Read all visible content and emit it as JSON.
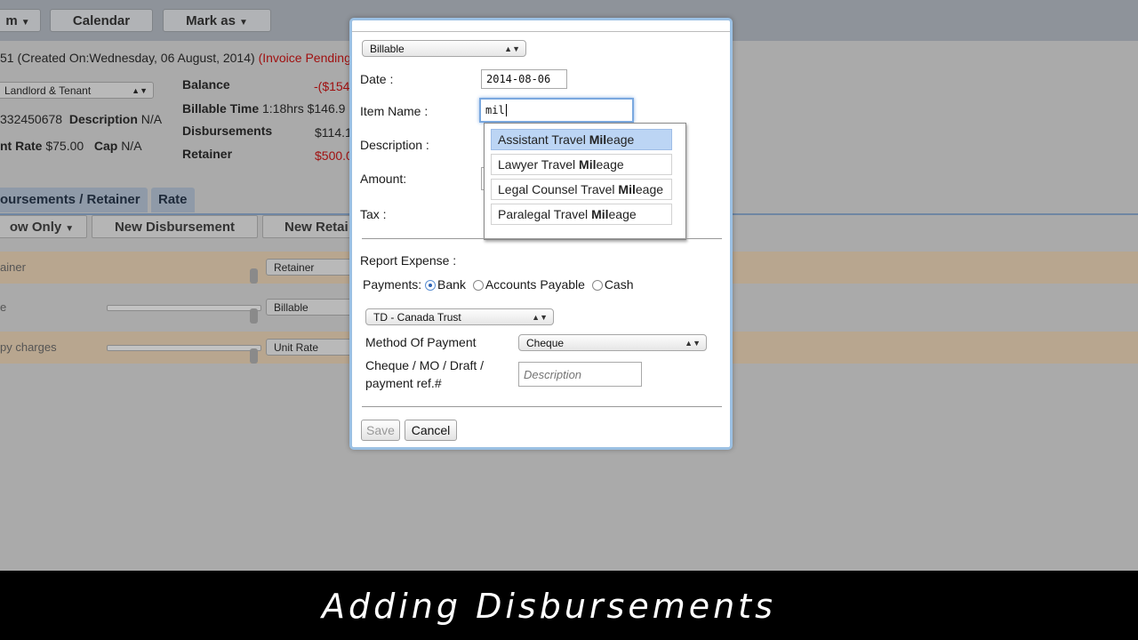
{
  "toolbar": {
    "btn1_label": "m",
    "calendar_label": "Calendar",
    "mark_as_label": "Mark as"
  },
  "matter": {
    "header_fragment": "51 (Created On:Wednesday, 06 August, 2014)",
    "status": "(Invoice Pending",
    "type_select": "Landlord & Tenant",
    "phone_fragment": "332450678",
    "description_label": "Description",
    "description_value": "N/A",
    "rate_label_fragment": "nt Rate",
    "rate_value": "$75.00",
    "cap_label": "Cap",
    "cap_value": "N/A",
    "balance_label": "Balance",
    "balance_value": "-($154",
    "billable_time_label": "Billable Time",
    "billable_time_value": "1:18hrs $146.9",
    "disbursements_label": "Disbursements",
    "disbursements_value": "$114.1",
    "retainer_label": "Retainer",
    "retainer_value": "$500.0"
  },
  "tabs": [
    {
      "label": "oursements / Retainer"
    },
    {
      "label": "Rate"
    }
  ],
  "subtoolbar": {
    "show_only": "ow Only",
    "new_disbursement": "New Disbursement",
    "new_retainer": "New Retai"
  },
  "rows": [
    {
      "text": "ainer",
      "select": "Retainer"
    },
    {
      "text": "e",
      "select": "Billable"
    },
    {
      "text": "py charges",
      "select": "Unit Rate"
    }
  ],
  "modal": {
    "type_select": "Billable",
    "date_label": "Date :",
    "date_value": "2014-08-06",
    "item_name_label": "Item Name :",
    "item_name_value": "mil",
    "description_label": "Description :",
    "amount_label": "Amount:",
    "tax_label": "Tax :",
    "autocomplete": [
      {
        "prefix": "Assistant Travel ",
        "match": "Mil",
        "suffix": "eage"
      },
      {
        "prefix": "Lawyer Travel ",
        "match": "Mil",
        "suffix": "eage"
      },
      {
        "prefix": "Legal Counsel Travel ",
        "match": "Mil",
        "suffix": "eage"
      },
      {
        "prefix": "Paralegal Travel ",
        "match": "Mil",
        "suffix": "eage"
      }
    ],
    "report_expense_label": "Report Expense :",
    "payments_label": "Payments:",
    "payment_options": [
      "Bank",
      "Accounts Payable",
      "Cash"
    ],
    "account_select": "TD - Canada Trust",
    "method_label": "Method Of Payment",
    "method_select": "Cheque",
    "cheque_label_1": "Cheque / MO / Draft /",
    "cheque_label_2": "payment ref.#",
    "cheque_placeholder": "Description",
    "save_label": "Save",
    "cancel_label": "Cancel"
  },
  "caption": "Adding Disbursements"
}
